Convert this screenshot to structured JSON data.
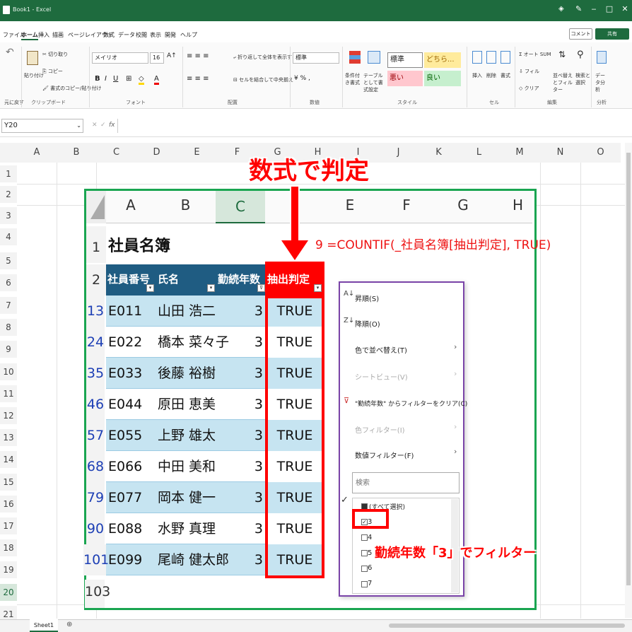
{
  "window": {
    "title": "Book1 - Excel",
    "controls": [
      "‒",
      "□",
      "✕"
    ]
  },
  "menu": [
    "ファイル",
    "ホーム",
    "挿入",
    "描画",
    "ページレイアウト",
    "数式",
    "データ",
    "校閲",
    "表示",
    "開発",
    "ヘルプ"
  ],
  "menu_right": {
    "comment": "コメント",
    "share": "共有"
  },
  "ribbon": {
    "undo_label": "元に戻す",
    "clipboard": {
      "paste": "貼り付け",
      "cut": "切り取り",
      "copy": "コピー",
      "painter": "書式のコピー/貼り付け",
      "label": "クリップボード"
    },
    "font": {
      "name": "メイリオ",
      "size": "16",
      "label": "フォント"
    },
    "align": {
      "wrap": "折り返して全体を表示する",
      "merge": "セルを結合して中央揃え",
      "label": "配置"
    },
    "number": {
      "format": "標準",
      "label": "数値"
    },
    "styles": {
      "cond": "条件付き書式",
      "table": "テーブルとして書式設定",
      "label": "スタイル",
      "normal": "標準",
      "neutral": "どちら...",
      "bad": "悪い",
      "good": "良い"
    },
    "cells": {
      "insert": "挿入",
      "delete": "削除",
      "format": "書式",
      "label": "セル"
    },
    "edit": {
      "autosum": "オート SUM",
      "fill": "フィル",
      "clear": "クリア",
      "sort": "並べ替えとフィルター",
      "find": "検索と選択",
      "label": "編集"
    },
    "analysis": {
      "data": "データ分析",
      "label": "分析"
    }
  },
  "formula_bar": {
    "namebox": "Y20",
    "cancel": "✕",
    "confirm": "✓",
    "fx": "fx",
    "value": ""
  },
  "columns": [
    "A",
    "B",
    "C",
    "D",
    "E",
    "F",
    "G",
    "H",
    "I",
    "J",
    "K",
    "L",
    "M",
    "N",
    "O"
  ],
  "rows": [
    "1",
    "2",
    "3",
    "4",
    "5",
    "6",
    "7",
    "8",
    "9",
    "10",
    "11",
    "12",
    "13",
    "14",
    "15",
    "16",
    "17",
    "18",
    "19",
    "20",
    "21"
  ],
  "annotation_top": "数式で判定",
  "inner": {
    "cols": [
      "A",
      "B",
      "C",
      "",
      "E",
      "F",
      "G",
      "H"
    ],
    "title": "社員名簿",
    "row1": "1",
    "row2": "2",
    "row_last": "103",
    "headers": [
      "社員番号",
      "氏名",
      "勤続年数",
      "抽出判定"
    ],
    "formula_note": "9 =COUNTIF(_社員名簿[抽出判定], TRUE)",
    "records": [
      {
        "idx": "13",
        "id": "E011",
        "name": "山田 浩二",
        "years": "3",
        "flag": "TRUE"
      },
      {
        "idx": "24",
        "id": "E022",
        "name": "橋本 菜々子",
        "years": "3",
        "flag": "TRUE"
      },
      {
        "idx": "35",
        "id": "E033",
        "name": "後藤 裕樹",
        "years": "3",
        "flag": "TRUE"
      },
      {
        "idx": "46",
        "id": "E044",
        "name": "原田 恵美",
        "years": "3",
        "flag": "TRUE"
      },
      {
        "idx": "57",
        "id": "E055",
        "name": "上野 雄太",
        "years": "3",
        "flag": "TRUE"
      },
      {
        "idx": "68",
        "id": "E066",
        "name": "中田 美和",
        "years": "3",
        "flag": "TRUE"
      },
      {
        "idx": "79",
        "id": "E077",
        "name": "岡本 健一",
        "years": "3",
        "flag": "TRUE"
      },
      {
        "idx": "90",
        "id": "E088",
        "name": "水野 真理",
        "years": "3",
        "flag": "TRUE"
      },
      {
        "idx": "101",
        "id": "E099",
        "name": "尾崎 健太郎",
        "years": "3",
        "flag": "TRUE"
      }
    ]
  },
  "filter_menu": {
    "asc": "昇順(S)",
    "desc": "降順(O)",
    "color_sort": "色で並べ替え(T)",
    "sheet_view": "シートビュー(V)",
    "clear": "\"勤続年数\" からフィルターをクリア(C)",
    "color_filter": "色フィルター(I)",
    "num_filter": "数値フィルター(F)",
    "search_placeholder": "検索",
    "items": [
      "(すべて選択)",
      "3",
      "4",
      "5",
      "6",
      "7"
    ]
  },
  "annotation_filter": "勤続年数「3」でフィルター",
  "sheet_tab": "Sheet1",
  "colors": {
    "excel_green": "#1e6b3e",
    "header_blue": "#1f5c82",
    "band": "#c6e4f1",
    "highlight_red": "#ff0000",
    "callout_green": "#1aa551",
    "callout_purple": "#7a44a8"
  }
}
